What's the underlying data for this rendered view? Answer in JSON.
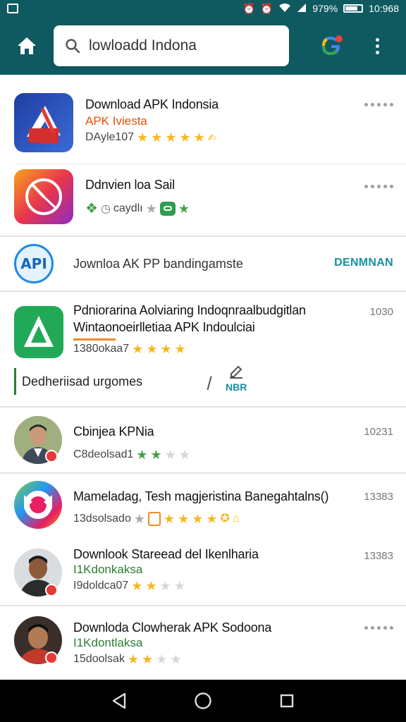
{
  "status_bar": {
    "battery": "979%",
    "time": "10:968"
  },
  "search": {
    "value": "lowloadd Indona"
  },
  "colors": {
    "app_bar": "#0f5a60",
    "accent": "#1690a6",
    "star": "#f9b71c"
  },
  "items": [
    {
      "title": "Download APK Indonsia",
      "subtitle": "APK Iviesta",
      "meta": "DAyle107"
    },
    {
      "title": "Ddnvien loa Sail",
      "meta": "caydlı"
    },
    {
      "promo_label": "Jownloa AK PP bandingamste",
      "promo_action": "DENMNAN"
    },
    {
      "title_line1": "Pdniorarina Aolviaring Indoqnraalbudgitlan",
      "title_line2": "Wintaonoeirlletiaa APK Indoulciai",
      "meta": "1380okaa7",
      "right": "1030"
    },
    {
      "tag": "Dedheriisad urgomes",
      "new_label": "NBR"
    },
    {
      "title": "Cbinjea KPNia",
      "meta": "C8deolsad1",
      "right": "10231"
    },
    {
      "title": "Mameladag, Tesh magjeristina Banegahtalns()",
      "meta": "13dsolsado",
      "right": "13383"
    },
    {
      "title": "Downlook Stareead del Ikenlharia",
      "subtitle": "I1Kdonkaksa",
      "meta": "I9doldca07",
      "right": "13383"
    },
    {
      "title": "Downloda Clowherak APK Sodoona",
      "subtitle": "I1Kdontlaksa",
      "meta": "15doolsak"
    }
  ]
}
